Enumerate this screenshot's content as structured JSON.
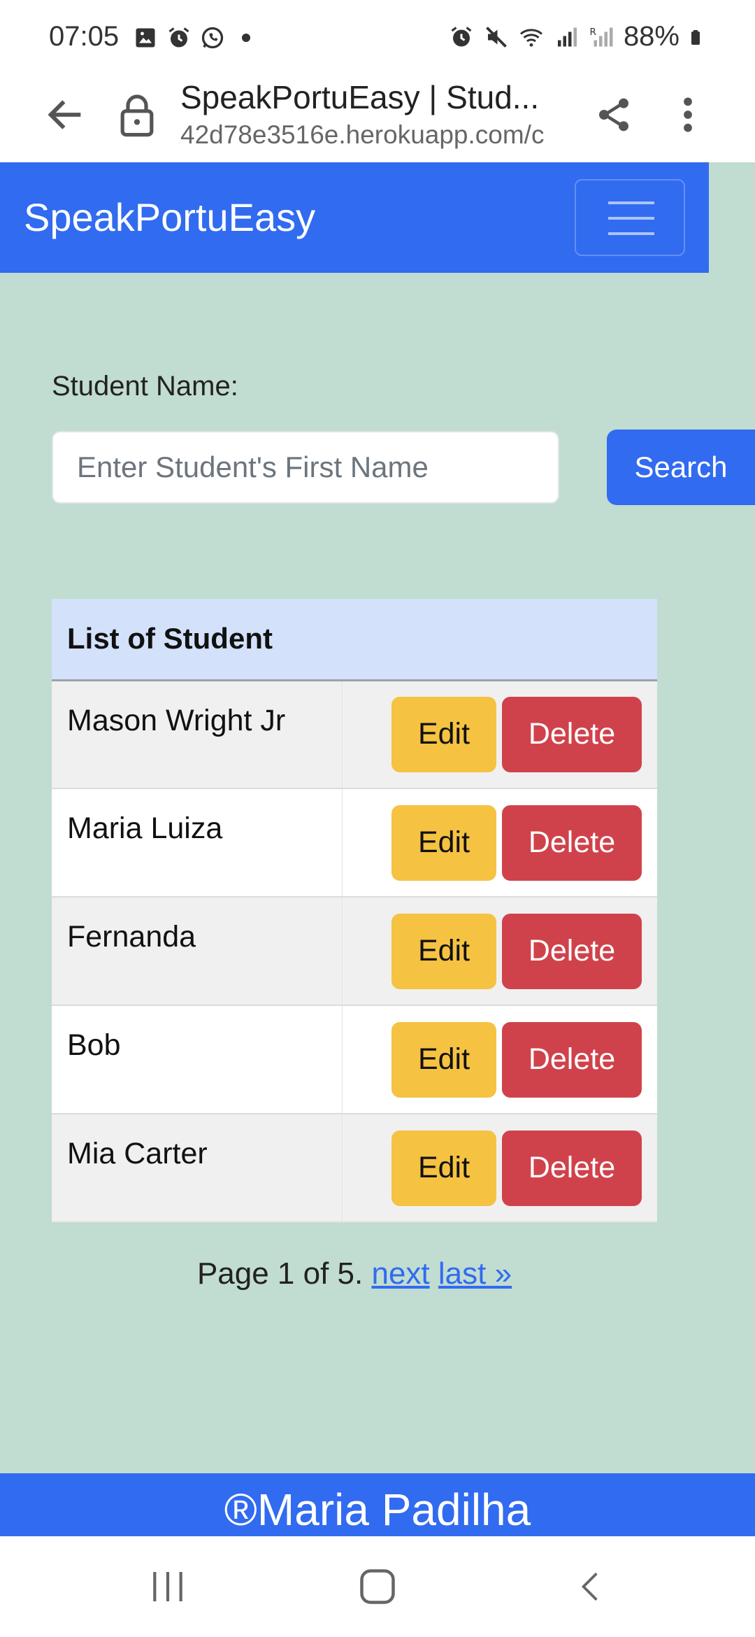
{
  "status_bar": {
    "time": "07:05",
    "battery": "88%",
    "left_icons": [
      "gallery-icon",
      "alarm-icon",
      "whatsapp-icon",
      "dot-icon"
    ],
    "right_icons": [
      "alarm-icon",
      "mute-icon",
      "wifi-icon",
      "signal-icon",
      "signal-roaming-icon",
      "battery-icon"
    ]
  },
  "browser": {
    "title": "SpeakPortuEasy | Stud...",
    "url": "42d78e3516e.herokuapp.com/c"
  },
  "navbar": {
    "brand": "SpeakPortuEasy"
  },
  "search": {
    "label": "Student Name:",
    "placeholder": "Enter Student's First Name",
    "value": "",
    "button_label": "Search"
  },
  "table": {
    "header": "List of Student",
    "edit_label": "Edit",
    "delete_label": "Delete",
    "rows": [
      {
        "name": "Mason Wright Jr"
      },
      {
        "name": "Maria Luiza"
      },
      {
        "name": "Fernanda"
      },
      {
        "name": "Bob"
      },
      {
        "name": "Mia Carter"
      }
    ]
  },
  "pagination": {
    "text": "Page 1 of 5.",
    "next": "next",
    "last": "last »"
  },
  "footer": {
    "text": "®Maria Padilha"
  },
  "colors": {
    "primary": "#316bf0",
    "page_background": "#c1dcd1",
    "edit": "#f5c242",
    "delete": "#d0424b",
    "table_header": "#d3e1fb"
  }
}
